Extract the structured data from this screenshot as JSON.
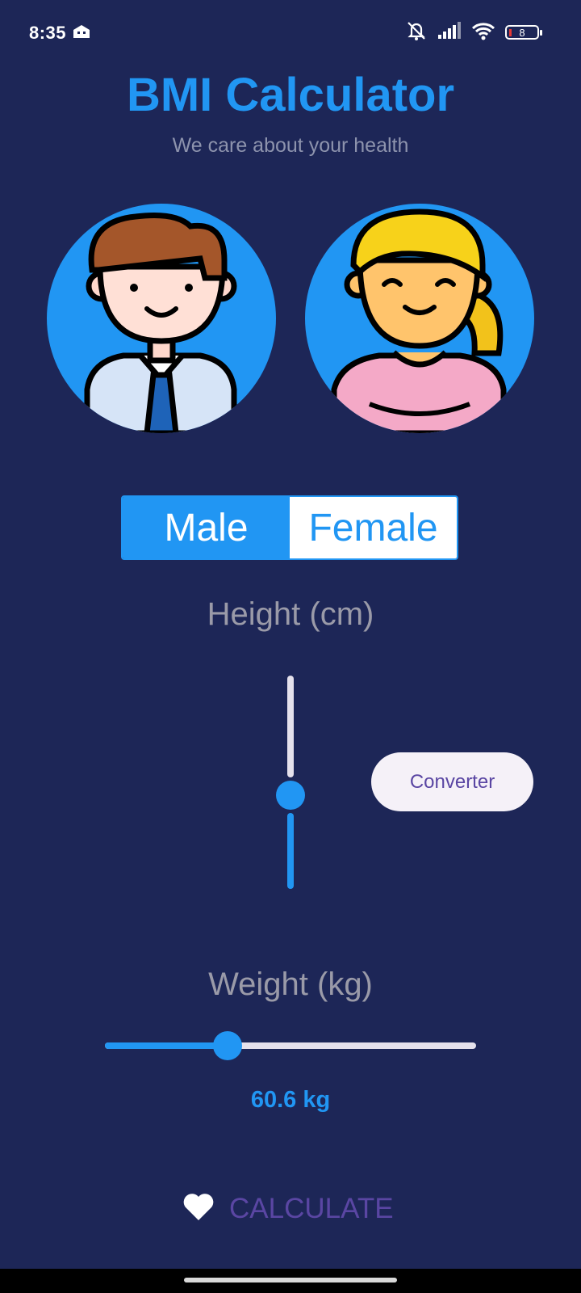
{
  "status_bar": {
    "time": "8:35",
    "battery_level": "8"
  },
  "header": {
    "title": "BMI Calculator",
    "subtitle": "We care about your health"
  },
  "gender_toggle": {
    "options": [
      "Male",
      "Female"
    ],
    "selected": "Male"
  },
  "height": {
    "label": "Height (cm)",
    "slider_fraction": 0.44
  },
  "converter_button": {
    "label": "Converter"
  },
  "weight": {
    "label": "Weight (kg)",
    "value_text": "60.6 kg",
    "slider_fraction": 0.33
  },
  "calculate_button": {
    "label": "CALCULATE",
    "icon": "heart-icon"
  },
  "colors": {
    "background": "#1d2657",
    "accent": "#2196f3",
    "secondary_text": "#9a9aa8",
    "button_text": "#5a46a3"
  }
}
